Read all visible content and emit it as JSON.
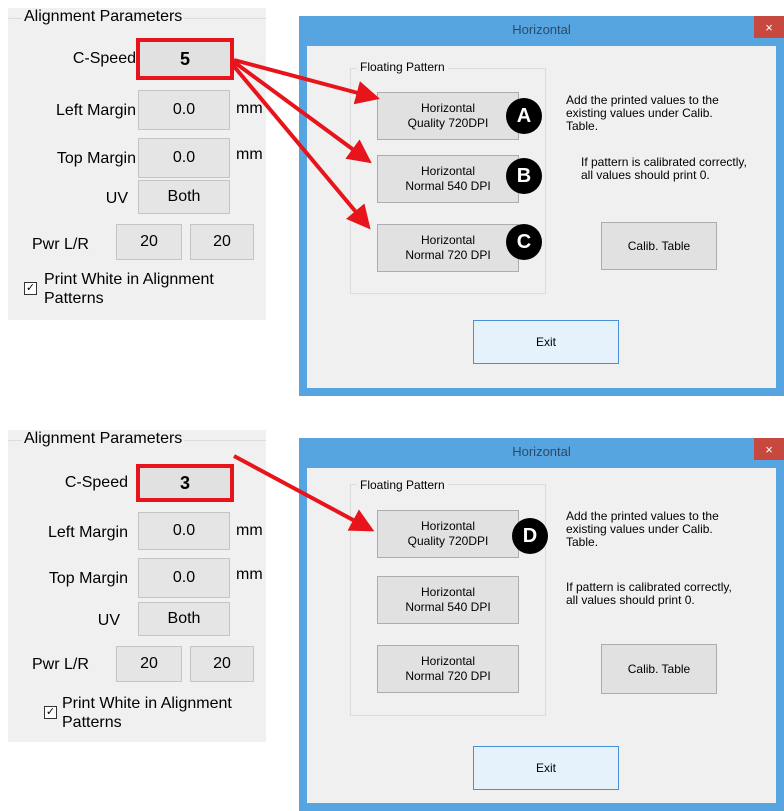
{
  "panels": [
    {
      "title": "Alignment Parameters",
      "c_speed_label": "C-Speed",
      "c_speed_value": "5",
      "left_margin_label": "Left Margin",
      "left_margin_value": "0.0",
      "left_margin_unit": "mm",
      "top_margin_label": "Top Margin",
      "top_margin_value": "0.0",
      "top_margin_unit": "mm",
      "uv_label": "UV",
      "uv_value": "Both",
      "pwr_label": "Pwr L/R",
      "pwr_left": "20",
      "pwr_right": "20",
      "print_white_line1": "Print White in Alignment",
      "print_white_line2": "Patterns",
      "print_white_checked": true
    },
    {
      "title": "Alignment Parameters",
      "c_speed_label": "C-Speed",
      "c_speed_value": "3",
      "left_margin_label": "Left Margin",
      "left_margin_value": "0.0",
      "left_margin_unit": "mm",
      "top_margin_label": "Top Margin",
      "top_margin_value": "0.0",
      "top_margin_unit": "mm",
      "uv_label": "UV",
      "uv_value": "Both",
      "pwr_label": "Pwr L/R",
      "pwr_left": "20",
      "pwr_right": "20",
      "print_white_line1": "Print White in Alignment",
      "print_white_line2": "Patterns",
      "print_white_checked": true
    }
  ],
  "dialogs": [
    {
      "title": "Horizontal",
      "close_glyph": "×",
      "group_title": "Floating Pattern",
      "btn1_line1": "Horizontal",
      "btn1_line2": "Quality 720DPI",
      "btn2_line1": "Horizontal",
      "btn2_line2": "Normal 540 DPI",
      "btn3_line1": "Horizontal",
      "btn3_line2": "Normal 720 DPI",
      "note1_line1": "Add the printed values to the",
      "note1_line2": "existing values under Calib.",
      "note1_line3": "Table.",
      "note2_line1": "If pattern is calibrated correctly,",
      "note2_line2": "all values should print 0.",
      "calib_label": "Calib. Table",
      "exit_label": "Exit"
    },
    {
      "title": "Horizontal",
      "close_glyph": "×",
      "group_title": "Floating Pattern",
      "btn1_line1": "Horizontal",
      "btn1_line2": "Quality 720DPI",
      "btn2_line1": "Horizontal",
      "btn2_line2": "Normal 540 DPI",
      "btn3_line1": "Horizontal",
      "btn3_line2": "Normal 720 DPI",
      "note1_line1": "Add the printed values to the",
      "note1_line2": "existing values under Calib.",
      "note1_line3": "Table.",
      "note2_line1": "If pattern is calibrated correctly,",
      "note2_line2": "all values should print 0.",
      "calib_label": "Calib. Table",
      "exit_label": "Exit"
    }
  ],
  "callouts": {
    "a": "A",
    "b": "B",
    "c": "C",
    "d": "D"
  },
  "colors": {
    "highlight_red": "#e8141b",
    "window_border_blue": "#56a5e0",
    "close_button_red": "#c7483f",
    "badge_black": "#000000"
  }
}
